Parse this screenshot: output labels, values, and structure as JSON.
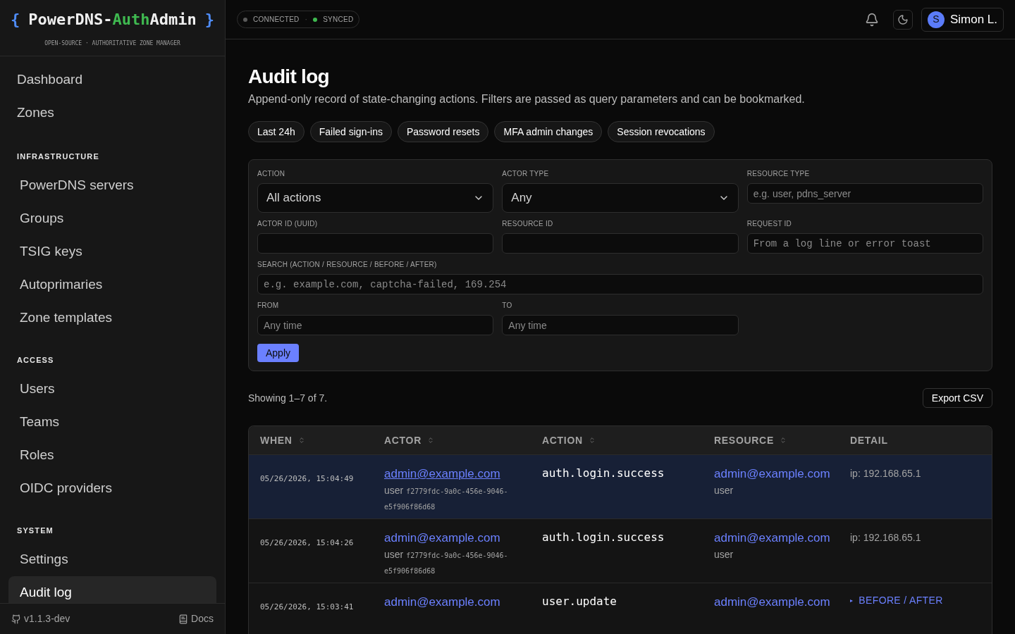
{
  "logo": {
    "open": "{",
    "name": "PowerDNS-",
    "accent": "Auth",
    "name_rest": "Admin",
    "close": "}",
    "tagline": "OPEN-SOURCE · AUTHORITATIVE ZONE MANAGER"
  },
  "status": {
    "items": [
      {
        "label": "CONNECTED",
        "color": "#5a5a5a"
      },
      {
        "label": "SYNCED",
        "color": "#3fb950"
      }
    ],
    "separator": "·"
  },
  "user": {
    "initial": "S",
    "name": "Simon L."
  },
  "sidebar": {
    "sections": [
      {
        "items": [
          {
            "label": "Dashboard",
            "selected": false
          },
          {
            "label": "Zones",
            "selected": false
          }
        ]
      },
      {
        "title": "INFRASTRUCTURE",
        "items": [
          {
            "label": "PowerDNS servers",
            "selected": false
          },
          {
            "label": "Groups",
            "selected": false
          },
          {
            "label": "TSIG keys",
            "selected": false
          },
          {
            "label": "Autoprimaries",
            "selected": false
          },
          {
            "label": "Zone templates",
            "selected": false
          }
        ]
      },
      {
        "title": "ACCESS",
        "items": [
          {
            "label": "Users",
            "selected": false
          },
          {
            "label": "Teams",
            "selected": false
          },
          {
            "label": "Roles",
            "selected": false
          },
          {
            "label": "OIDC providers",
            "selected": false
          }
        ]
      },
      {
        "title": "SYSTEM",
        "items": [
          {
            "label": "Settings",
            "selected": false
          },
          {
            "label": "Audit log",
            "selected": true
          }
        ]
      }
    ],
    "version": "v1.1.3-dev",
    "docs": "Docs"
  },
  "page": {
    "title": "Audit log",
    "subtitle": "Append-only record of state-changing actions. Filters are passed as query parameters and can be bookmarked."
  },
  "presets": [
    "Last 24h",
    "Failed sign-ins",
    "Password resets",
    "MFA admin changes",
    "Session revocations"
  ],
  "filters": [
    {
      "kind": "select",
      "label": "ACTION",
      "value": "All actions"
    },
    {
      "kind": "select",
      "label": "ACTOR TYPE",
      "value": "Any"
    },
    {
      "kind": "text",
      "label": "RESOURCE TYPE",
      "placeholder": "e.g. user, pdns_server"
    },
    {
      "kind": "text",
      "label": "ACTOR ID (UUID)"
    },
    {
      "kind": "text",
      "label": "RESOURCE ID"
    },
    {
      "kind": "mono",
      "label": "REQUEST ID",
      "placeholder": "From a log line or error toast"
    },
    {
      "kind": "search",
      "label": "SEARCH (ACTION / RESOURCE / BEFORE / AFTER)",
      "placeholder": "e.g. example.com, captcha-failed, 169.254"
    },
    {
      "kind": "text",
      "label": "FROM",
      "placeholder": "Any time"
    },
    {
      "kind": "text",
      "label": "TO",
      "placeholder": "Any time"
    }
  ],
  "apply": "Apply",
  "summary": "Showing 1–7 of 7.",
  "export": "Export CSV",
  "table": {
    "columns": [
      {
        "label": "WHEN",
        "sortable": true
      },
      {
        "label": "ACTOR",
        "sortable": true
      },
      {
        "label": "ACTION",
        "sortable": true
      },
      {
        "label": "RESOURCE",
        "sortable": true
      },
      {
        "label": "DETAIL",
        "sortable": false
      }
    ],
    "rows": [
      {
        "selected": true,
        "when": "05/26/2026, 15:04:49",
        "actor": "admin@example.com",
        "actor_type": "user",
        "actor_id": "f2779fdc-9a0c-456e-9046-e5f906f86d68",
        "action": "auth.login.success",
        "resource": "admin@example.com",
        "resource_type": "user",
        "detail": {
          "kind": "text",
          "text": "ip: 192.168.65.1"
        }
      },
      {
        "selected": false,
        "when": "05/26/2026, 15:04:26",
        "actor": "admin@example.com",
        "actor_type": "user",
        "actor_id": "f2779fdc-9a0c-456e-9046-e5f906f86d68",
        "action": "auth.login.success",
        "resource": "admin@example.com",
        "resource_type": "user",
        "detail": {
          "kind": "text",
          "text": "ip: 192.168.65.1"
        }
      },
      {
        "selected": false,
        "when": "05/26/2026, 15:03:41",
        "actor": "admin@example.com",
        "action": "user.update",
        "resource": "admin@example.com",
        "detail": {
          "kind": "toggle",
          "text": "BEFORE / AFTER",
          "marker": "▸"
        }
      }
    ]
  }
}
